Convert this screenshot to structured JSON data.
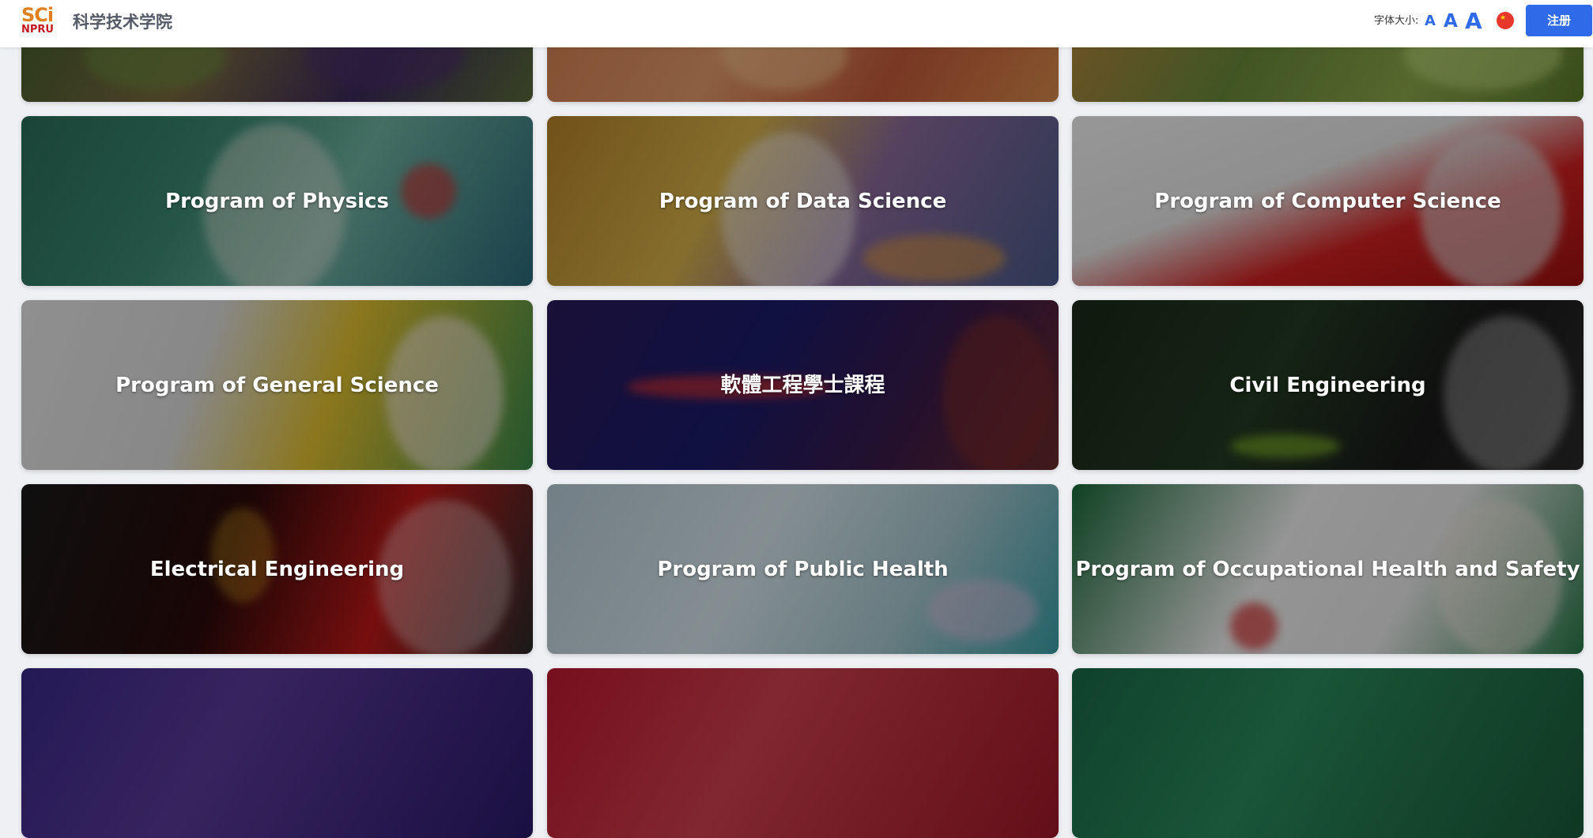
{
  "header": {
    "logo_sci": "SCi",
    "logo_npru": "NPRU",
    "site_title": "科学技术学院",
    "font_size_label": "字体大小:",
    "font_small": "A",
    "font_medium": "A",
    "font_large": "A",
    "language_flag": "china-flag-icon",
    "register_label": "注册"
  },
  "colors": {
    "accent": "#2f6be8",
    "logo_orange": "#e07f1d",
    "logo_red": "#c2191f"
  },
  "programs": [
    {
      "label": ""
    },
    {
      "label": ""
    },
    {
      "label": ""
    },
    {
      "label": "Program of Physics"
    },
    {
      "label": "Program of Data Science"
    },
    {
      "label": "Program of Computer Science"
    },
    {
      "label": "Program of General Science"
    },
    {
      "label": "軟體工程學士課程"
    },
    {
      "label": "Civil Engineering"
    },
    {
      "label": "Electrical Engineering"
    },
    {
      "label": "Program of Public Health"
    },
    {
      "label": "Program of Occupational Health and Safety"
    },
    {
      "label": ""
    },
    {
      "label": ""
    },
    {
      "label": ""
    }
  ]
}
